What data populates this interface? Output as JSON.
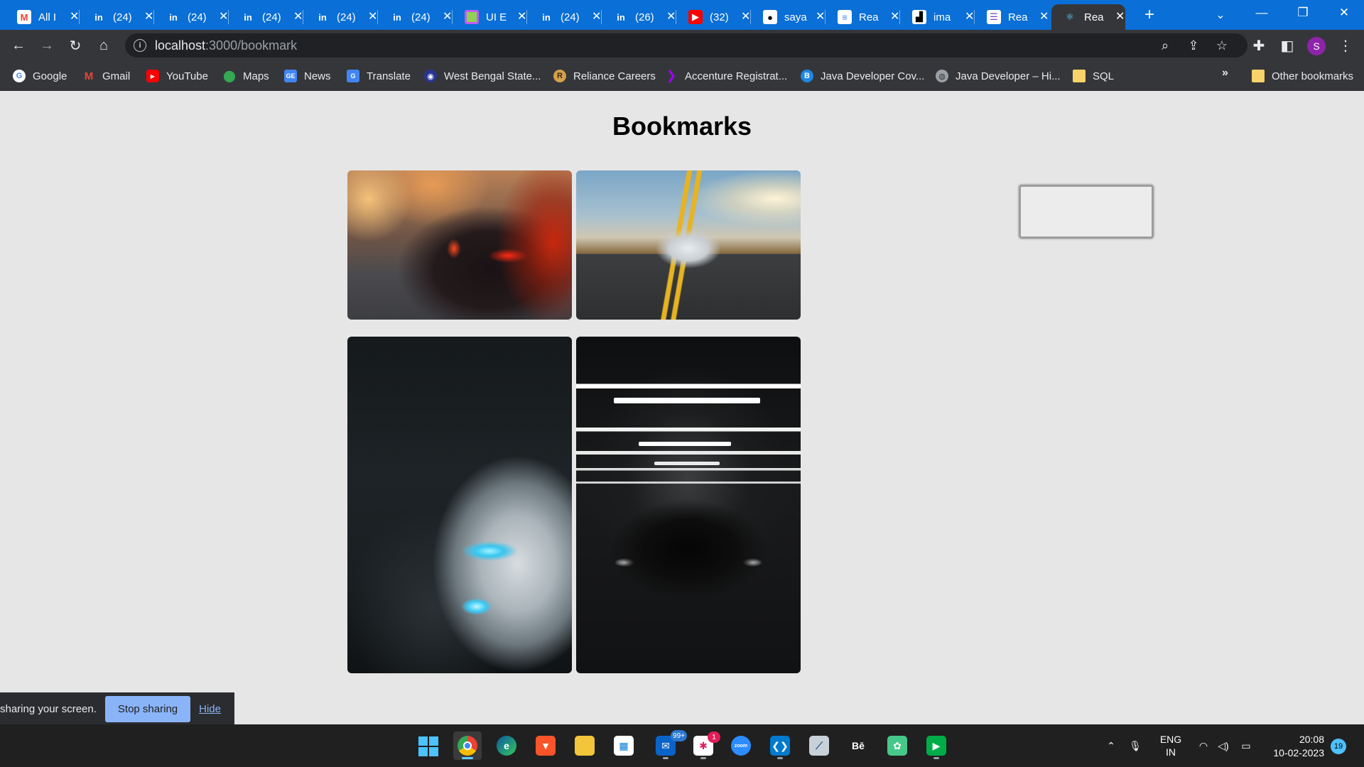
{
  "browser": {
    "tabs": [
      {
        "icon": "gmail-icon",
        "label": "All I"
      },
      {
        "icon": "linkedin-icon",
        "label": "(24)"
      },
      {
        "icon": "linkedin-icon",
        "label": "(24)"
      },
      {
        "icon": "linkedin-icon",
        "label": "(24)"
      },
      {
        "icon": "linkedin-icon",
        "label": "(24)"
      },
      {
        "icon": "linkedin-icon",
        "label": "(24)"
      },
      {
        "icon": "circle-icon",
        "label": "UI E"
      },
      {
        "icon": "linkedin-icon",
        "label": "(24)"
      },
      {
        "icon": "linkedin-icon",
        "label": "(26)"
      },
      {
        "icon": "youtube-icon",
        "label": "(32)"
      },
      {
        "icon": "github-icon",
        "label": "saya"
      },
      {
        "icon": "docs-icon",
        "label": "Rea"
      },
      {
        "icon": "unsplash-icon",
        "label": "ima"
      },
      {
        "icon": "forms-icon",
        "label": "Rea"
      },
      {
        "icon": "react-icon",
        "label": "Rea"
      }
    ],
    "active_tab_index": 14,
    "address": {
      "host": "localhost",
      "path": ":3000/bookmark"
    },
    "profile_initial": "S",
    "bookmarks": [
      {
        "label": "Google",
        "icon": "google-icon"
      },
      {
        "label": "Gmail",
        "icon": "gmail-icon"
      },
      {
        "label": "YouTube",
        "icon": "youtube-icon"
      },
      {
        "label": "Maps",
        "icon": "maps-icon"
      },
      {
        "label": "News",
        "icon": "news-icon"
      },
      {
        "label": "Translate",
        "icon": "translate-icon"
      },
      {
        "label": "West Bengal State...",
        "icon": "wb-icon"
      },
      {
        "label": "Reliance Careers",
        "icon": "reliance-icon"
      },
      {
        "label": "Accenture Registrat...",
        "icon": "accenture-icon"
      },
      {
        "label": "Java Developer Cov...",
        "icon": "java-icon"
      },
      {
        "label": "Java Developer – Hi...",
        "icon": "globe-icon"
      },
      {
        "label": "SQL",
        "icon": "folder-icon"
      }
    ],
    "other_bookmarks": "Other bookmarks"
  },
  "page": {
    "title": "Bookmarks",
    "photos": [
      {
        "name": "car-photo-red-taillights"
      },
      {
        "name": "car-photo-road-sunset"
      },
      {
        "name": "car-photo-white-headlight"
      },
      {
        "name": "car-photo-dark-garage"
      }
    ]
  },
  "share_bar": {
    "message": "sharing your screen.",
    "stop_label": "Stop sharing",
    "hide_label": "Hide"
  },
  "taskbar": {
    "mail_badge": "99+",
    "slack_badge": "1",
    "language": "ENG",
    "region": "IN",
    "time": "20:08",
    "date": "10-02-2023",
    "notifications": "19"
  },
  "colors": {
    "tab_strip": "#0a6fd6",
    "toolbar": "#35363a",
    "page_background": "#e6e6e6",
    "stop_button": "#8ab4f8"
  }
}
